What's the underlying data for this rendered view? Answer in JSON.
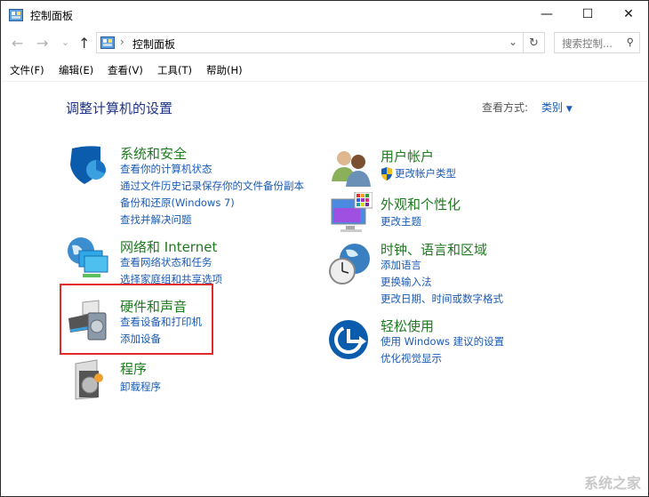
{
  "window": {
    "title": "控制面板",
    "minimize": "—",
    "maximize": "☐",
    "close": "✕"
  },
  "nav": {
    "back": "←",
    "forward": "→",
    "recent": "⌄",
    "up": "↑",
    "breadcrumb_sep": "›",
    "breadcrumb": "控制面板",
    "dropdown": "⌄",
    "refresh": "↻",
    "search_placeholder": "搜索控制...",
    "search_icon": "⚲"
  },
  "menu": [
    "文件(F)",
    "编辑(E)",
    "查看(V)",
    "工具(T)",
    "帮助(H)"
  ],
  "heading": "调整计算机的设置",
  "view": {
    "label": "查看方式:",
    "value": "类别",
    "arrow": "▼"
  },
  "left": [
    {
      "title": "系统和安全",
      "links": [
        "查看你的计算机状态",
        "通过文件历史记录保存你的文件备份副本",
        "备份和还原(Windows 7)",
        "查找并解决问题"
      ]
    },
    {
      "title": "网络和 Internet",
      "links": [
        "查看网络状态和任务",
        "选择家庭组和共享选项"
      ]
    },
    {
      "title": "硬件和声音",
      "links": [
        "查看设备和打印机",
        "添加设备"
      ]
    },
    {
      "title": "程序",
      "links": [
        "卸载程序"
      ]
    }
  ],
  "right": [
    {
      "title": "用户帐户",
      "links": [
        "更改帐户类型"
      ]
    },
    {
      "title": "外观和个性化",
      "links": [
        "更改主题"
      ]
    },
    {
      "title": "时钟、语言和区域",
      "links": [
        "添加语言",
        "更换输入法",
        "更改日期、时间或数字格式"
      ]
    },
    {
      "title": "轻松使用",
      "links": [
        "使用 Windows 建议的设置",
        "优化视觉显示"
      ]
    }
  ],
  "watermark": "系统之家",
  "colors": {
    "title_green": "#1e7a1e",
    "link_blue": "#1a5bb5",
    "highlight_red": "#e02a2a"
  }
}
